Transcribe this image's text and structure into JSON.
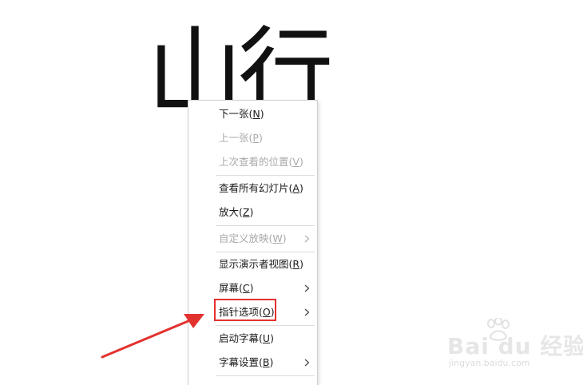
{
  "slide": {
    "title": "山行"
  },
  "menu": {
    "items": [
      {
        "label": "下一张",
        "key": "N",
        "disabled": false,
        "submenu": false
      },
      {
        "label": "上一张",
        "key": "P",
        "disabled": true,
        "submenu": false
      },
      {
        "label": "上次查看的位置",
        "key": "V",
        "disabled": true,
        "submenu": false
      },
      {
        "label": "查看所有幻灯片",
        "key": "A",
        "disabled": false,
        "submenu": false
      },
      {
        "label": "放大",
        "key": "Z",
        "disabled": false,
        "submenu": false
      },
      {
        "label": "自定义放映",
        "key": "W",
        "disabled": true,
        "submenu": true
      },
      {
        "label": "显示演示者视图",
        "key": "R",
        "disabled": false,
        "submenu": false
      },
      {
        "label": "屏幕",
        "key": "C",
        "disabled": false,
        "submenu": true
      },
      {
        "label": "指针选项",
        "key": "O",
        "disabled": false,
        "submenu": true
      },
      {
        "label": "启动字幕",
        "key": "U",
        "disabled": false,
        "submenu": false
      },
      {
        "label": "字幕设置",
        "key": "B",
        "disabled": false,
        "submenu": true
      }
    ]
  },
  "annotation": {
    "highlight_color": "#e2322f",
    "highlighted_item": "指针选项"
  },
  "watermark": {
    "main": "Bai du 经验",
    "sub": "jingyan.baidu.com"
  }
}
